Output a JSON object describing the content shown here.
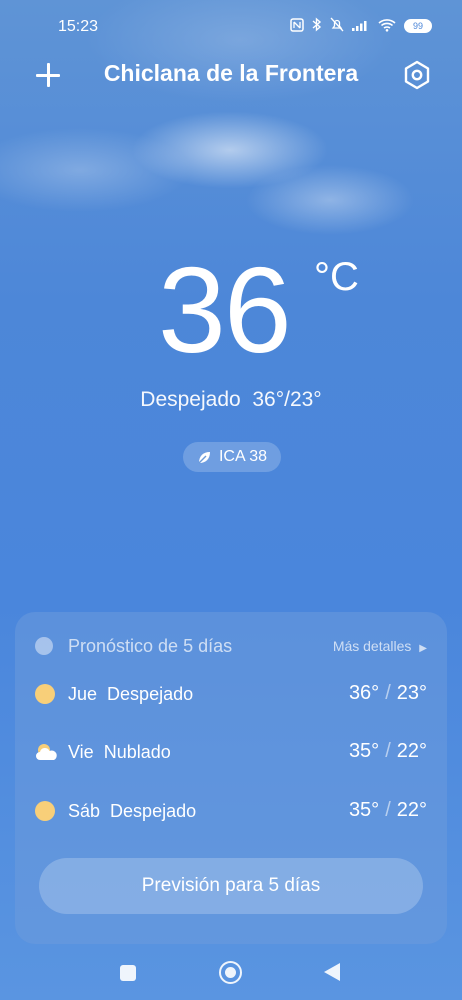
{
  "status": {
    "time": "15:23",
    "battery": "99",
    "icons": [
      "nfc-icon",
      "bluetooth-icon",
      "muted-icon",
      "signal-icon",
      "wifi-icon",
      "battery-icon"
    ]
  },
  "header": {
    "city": "Chiclana de la Frontera",
    "add_icon": "plus-icon",
    "settings_icon": "settings-icon"
  },
  "current": {
    "temperature": "36",
    "unit": "°C",
    "condition": "Despejado",
    "high_low": "36°/23°",
    "ica_label": "ICA 38"
  },
  "forecast": {
    "title": "Pronóstico de 5 días",
    "more_label": "Más detalles",
    "days": [
      {
        "day": "Jue",
        "condition": "Despejado",
        "high": "36°",
        "low": "23°",
        "icon": "sun-icon"
      },
      {
        "day": "Vie",
        "condition": "Nublado",
        "high": "35°",
        "low": "22°",
        "icon": "partly-cloudy-icon"
      },
      {
        "day": "Sáb",
        "condition": "Despejado",
        "high": "35°",
        "low": "22°",
        "icon": "sun-icon"
      }
    ],
    "button_label": "Previsión para 5 días"
  },
  "colors": {
    "sky_top": "#5f94d6",
    "sky_bottom": "#5a95e1",
    "sun": "#f8cf79"
  }
}
